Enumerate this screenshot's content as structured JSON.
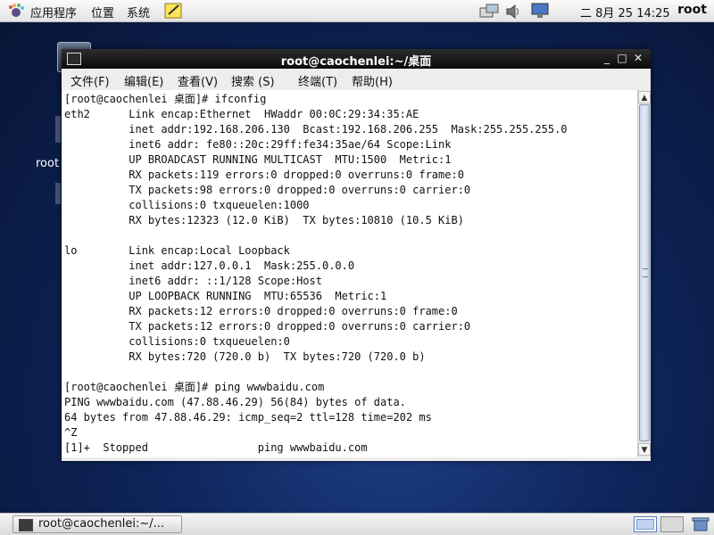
{
  "top_panel": {
    "menu": [
      "应用程序",
      "位置",
      "系统"
    ],
    "clock": "二 8月 25 14:25",
    "user": "root"
  },
  "desktop": {
    "icon_label": "root"
  },
  "window": {
    "title": "root@caochenlei:~/桌面",
    "menu": [
      "文件(F)",
      "编辑(E)",
      "查看(V)",
      "搜索 (S)",
      "终端(T)",
      "帮助(H)"
    ],
    "minimize": "_",
    "maximize": "□",
    "close": "✕"
  },
  "terminal_lines": [
    "[root@caochenlei 桌面]# ifconfig",
    "eth2      Link encap:Ethernet  HWaddr 00:0C:29:34:35:AE",
    "          inet addr:192.168.206.130  Bcast:192.168.206.255  Mask:255.255.255.0",
    "          inet6 addr: fe80::20c:29ff:fe34:35ae/64 Scope:Link",
    "          UP BROADCAST RUNNING MULTICAST  MTU:1500  Metric:1",
    "          RX packets:119 errors:0 dropped:0 overruns:0 frame:0",
    "          TX packets:98 errors:0 dropped:0 overruns:0 carrier:0",
    "          collisions:0 txqueuelen:1000",
    "          RX bytes:12323 (12.0 KiB)  TX bytes:10810 (10.5 KiB)",
    "",
    "lo        Link encap:Local Loopback",
    "          inet addr:127.0.0.1  Mask:255.0.0.0",
    "          inet6 addr: ::1/128 Scope:Host",
    "          UP LOOPBACK RUNNING  MTU:65536  Metric:1",
    "          RX packets:12 errors:0 dropped:0 overruns:0 frame:0",
    "          TX packets:12 errors:0 dropped:0 overruns:0 carrier:0",
    "          collisions:0 txqueuelen:0",
    "          RX bytes:720 (720.0 b)  TX bytes:720 (720.0 b)",
    "",
    "[root@caochenlei 桌面]# ping wwwbaidu.com",
    "PING wwwbaidu.com (47.88.46.29) 56(84) bytes of data.",
    "64 bytes from 47.88.46.29: icmp_seq=2 ttl=128 time=202 ms",
    "^Z",
    "[1]+  Stopped                 ping wwwbaidu.com"
  ],
  "taskbar": {
    "task_label": "root@caochenlei:~/..."
  },
  "icons": {
    "apps": "foot-logo-icon",
    "notes": "sticky-notes-icon",
    "network": "network-icon",
    "volume": "volume-icon",
    "display": "display-icon",
    "terminal": "terminal-icon",
    "trash": "trash-icon"
  }
}
